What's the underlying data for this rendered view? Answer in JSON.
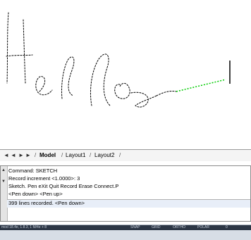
{
  "tabs": {
    "nav": [
      "◄",
      "◄",
      "►",
      "►"
    ],
    "model": "Model",
    "layout1": "Layout1",
    "layout2": "Layout2",
    "separator": "/"
  },
  "command_history": [
    "Command: SKETCH",
    "Record increment <1.0000>: 3",
    "Sketch. Pen eXit Quit Record Erase Connect.P",
    "<Pen down> <Pen up>"
  ],
  "command_input": "399 lines recorded. <Pen down>",
  "status": {
    "left": "mod 18.4e, 1.8.3, 1 M/4e + 8",
    "right": [
      "SNAP",
      "GRID",
      "ORTHO",
      "POLAR",
      "0"
    ]
  },
  "colors": {
    "sketch_line": "#000000",
    "rubberband": "#00cc00",
    "status_dark": "#2c3645"
  }
}
